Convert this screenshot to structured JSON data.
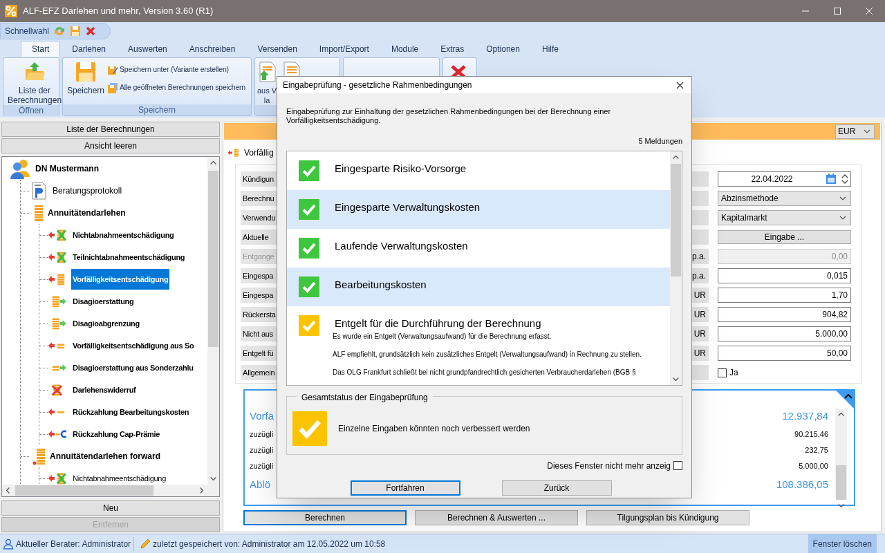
{
  "window": {
    "title": "ALF-EFZ Darlehen und mehr, Version 3.60 (R1)"
  },
  "quick_access": {
    "label": "Schnellwahl"
  },
  "ribbon": {
    "tabs": [
      {
        "label": "Start",
        "selected": true
      },
      {
        "label": "Darlehen",
        "selected": false
      },
      {
        "label": "Auswerten",
        "selected": false
      },
      {
        "label": "Anschreiben",
        "selected": false
      },
      {
        "label": "Versenden",
        "selected": false
      },
      {
        "label": "Import/Export",
        "selected": false
      },
      {
        "label": "Module",
        "selected": false
      },
      {
        "label": "Extras",
        "selected": false
      },
      {
        "label": "Optionen",
        "selected": false
      },
      {
        "label": "Hilfe",
        "selected": false
      }
    ],
    "groups": [
      {
        "label": "Öffnen",
        "buttons": [
          {
            "lines": [
              "Liste der",
              "Berechnungen"
            ]
          }
        ]
      },
      {
        "label": "Speichern",
        "buttons": [
          {
            "lines": [
              "Speichern"
            ]
          },
          {
            "lines": [
              "Speichern unter (Variante erstellen)"
            ]
          },
          {
            "lines": [
              "Alle geöffneten Berechnungen speichern"
            ]
          }
        ]
      },
      {
        "buttons": [
          {
            "lines": [
              "aus V",
              "la"
            ]
          }
        ]
      }
    ]
  },
  "sidebar": {
    "top_buttons": [
      "Liste der Berechnungen",
      "Ansicht leeren"
    ],
    "tree": [
      {
        "label": "DN Mustermann",
        "kind": "client",
        "bold": true,
        "selected": false,
        "children": [
          {
            "label": "Beratungsprotokoll",
            "kind": "protocol",
            "bold": false,
            "selected": false
          },
          {
            "label": "Annuitätendarlehen",
            "kind": "loan",
            "bold": true,
            "selected": false,
            "children": [
              {
                "label": "Nichtabnahmeentschädigung",
                "kind": "nae",
                "bold": true,
                "selected": false
              },
              {
                "label": "Teilnichtabnahmeentschädigung",
                "kind": "nae",
                "bold": true,
                "selected": false
              },
              {
                "label": "Vorfälligkeitsentschädigung",
                "kind": "vfe",
                "bold": true,
                "selected": true
              },
              {
                "label": "Disagioerstattung",
                "kind": "disagio",
                "bold": true,
                "selected": false
              },
              {
                "label": "Disagioabgrenzung",
                "kind": "disagio",
                "bold": true,
                "selected": false
              },
              {
                "label": "Vorfälligkeitsentschädigung aus So",
                "kind": "vfesonder",
                "bold": true,
                "selected": false
              },
              {
                "label": "Disagioerstattung aus Sonderzahlu",
                "kind": "disagiosonder",
                "bold": true,
                "selected": false
              },
              {
                "label": "Darlehenswiderruf",
                "kind": "widerruf",
                "bold": true,
                "selected": false
              },
              {
                "label": "Rückzahlung Bearbeitungskosten",
                "kind": "bearb",
                "bold": true,
                "selected": false
              },
              {
                "label": "Rückzahlung Cap-Prämie",
                "kind": "cap",
                "bold": true,
                "selected": false
              }
            ]
          },
          {
            "label": "Annuitätendarlehen forward",
            "kind": "forward",
            "bold": true,
            "selected": false,
            "children": [
              {
                "label": "Nichtabnahmeentschädigung",
                "kind": "nae",
                "bold": false,
                "selected": false
              }
            ]
          }
        ]
      }
    ],
    "bottom_buttons": [
      {
        "label": "Neu",
        "disabled": false
      },
      {
        "label": "Entfernen",
        "disabled": true
      }
    ]
  },
  "main": {
    "currency": "EUR",
    "document_tab": "Vorfällig",
    "form": [
      {
        "label": "Kündigun",
        "disabled": false,
        "control": {
          "kind": "date",
          "value": "22.04.2022"
        }
      },
      {
        "label": "Berechnu",
        "disabled": false,
        "control": {
          "kind": "select",
          "value": "Abzinsmethode"
        }
      },
      {
        "label": "Verwendu",
        "disabled": false,
        "control": {
          "kind": "select",
          "value": "Kapitalmarkt"
        }
      },
      {
        "label": "Aktuelle",
        "disabled": false,
        "control": {
          "kind": "button",
          "value": "Eingabe ..."
        }
      },
      {
        "label": "Entgange",
        "unit": "p.a.",
        "disabled": true,
        "control": {
          "kind": "number",
          "value": "0,00"
        }
      },
      {
        "label": "Eingespa",
        "unit": "p.a.",
        "disabled": false,
        "control": {
          "kind": "number",
          "value": "0,015"
        }
      },
      {
        "label": "Eingespa",
        "unit": "UR",
        "disabled": false,
        "control": {
          "kind": "number",
          "value": "1,70"
        }
      },
      {
        "label": "Rückersta",
        "unit": "UR",
        "disabled": false,
        "control": {
          "kind": "number",
          "value": "904,82"
        }
      },
      {
        "label": "Nicht aus",
        "unit": "UR",
        "disabled": false,
        "control": {
          "kind": "number",
          "value": "5.000,00"
        }
      },
      {
        "label": "Entgelt fü",
        "unit": "UR",
        "disabled": false,
        "control": {
          "kind": "number",
          "value": "50,00"
        }
      },
      {
        "label": "Allgemein",
        "disabled": false,
        "control": {
          "kind": "checkbox",
          "value": "Ja",
          "checked": false
        }
      }
    ],
    "result": {
      "expanded": true,
      "rows": [
        {
          "label": "Vorfä",
          "value": "12.937,84",
          "emphasis": true
        },
        {
          "label": "zuzügli",
          "value": "90.215,46",
          "emphasis": false
        },
        {
          "label": "zuzügli",
          "value": "232,75",
          "emphasis": false
        },
        {
          "label": "zuzügli",
          "value": "5.000,00",
          "emphasis": false
        },
        {
          "label": "Ablö",
          "value": "108.386,05",
          "emphasis": true
        }
      ]
    },
    "actions": [
      {
        "label": "Berechnen",
        "focused": true
      },
      {
        "label": "Berechnen & Auswerten ...",
        "focused": false
      },
      {
        "label": "Tilgungsplan bis Kündigung",
        "focused": false
      }
    ]
  },
  "dialog": {
    "title": "Eingabeprüfung - gesetzliche Rahmenbedingungen",
    "intro": "Eingabeprüfung zur Einhaltung der gesetzlichen Rahmenbedingungen bei der Berechnung einer Vorfälligkeitsentschädigung.",
    "count": "5 Meldungen",
    "messages": [
      {
        "title": "Eingesparte Risiko-Vorsorge",
        "kind": "ok"
      },
      {
        "title": "Eingesparte Verwaltungskosten",
        "kind": "ok"
      },
      {
        "title": "Laufende Verwaltungskosten",
        "kind": "ok"
      },
      {
        "title": "Bearbeitungskosten",
        "kind": "ok"
      },
      {
        "title": "Entgelt für die Durchführung der Berechnung",
        "kind": "warning",
        "details": [
          "Es wurde ein Entgelt (Verwaltungsaufwand) für die Berechnung erfasst.",
          "ALF empfiehlt, grundsätzlich kein zusätzliches Entgelt (Verwaltungsaufwand) in Rechnung zu stellen.",
          "Das OLG Frankfurt schließt bei nicht grundpfandrechtlich gesicherten Verbraucherdarlehen (BGB §"
        ]
      }
    ],
    "summary": {
      "title": "Gesamtstatus der Eingabeprüfung",
      "kind": "warning",
      "text": "Einzelne Eingaben könnten noch verbessert werden"
    },
    "dont_show": {
      "label": "Dieses Fenster nicht mehr anzeig",
      "checked": false
    },
    "buttons": [
      {
        "label": "Fortfahren",
        "focused": true
      },
      {
        "label": "Zurück",
        "focused": false
      }
    ]
  },
  "status_bar": {
    "items": [
      {
        "kind": "user",
        "text": "Aktueller Berater: Administrator"
      },
      {
        "kind": "pencil",
        "text": "zuletzt gespeichert von: Administrator am 12.05.2022 um 10:58"
      }
    ],
    "action": "Fenster löschen"
  }
}
